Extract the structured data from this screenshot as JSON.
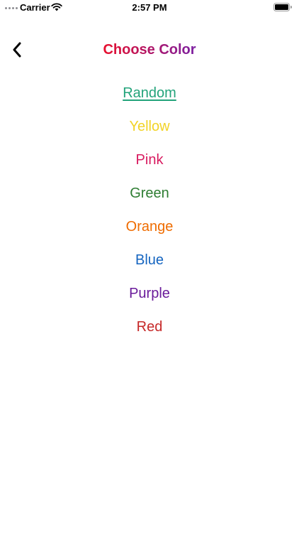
{
  "status_bar": {
    "carrier": "Carrier",
    "time": "2:57 PM"
  },
  "nav": {
    "title": "Choose Color",
    "title_gradient": [
      "#e8102e",
      "#7b1fa2"
    ],
    "back_icon": "chevron-left-icon"
  },
  "colors": [
    {
      "label": "Random",
      "color": "#22a37a",
      "underlined": true
    },
    {
      "label": "Yellow",
      "color": "#f2d326",
      "underlined": false
    },
    {
      "label": "Pink",
      "color": "#d81b60",
      "underlined": false
    },
    {
      "label": "Green",
      "color": "#2e7d32",
      "underlined": false
    },
    {
      "label": "Orange",
      "color": "#ef6c00",
      "underlined": false
    },
    {
      "label": "Blue",
      "color": "#1565c0",
      "underlined": false
    },
    {
      "label": "Purple",
      "color": "#6a1b9a",
      "underlined": false
    },
    {
      "label": "Red",
      "color": "#c62828",
      "underlined": false
    }
  ]
}
